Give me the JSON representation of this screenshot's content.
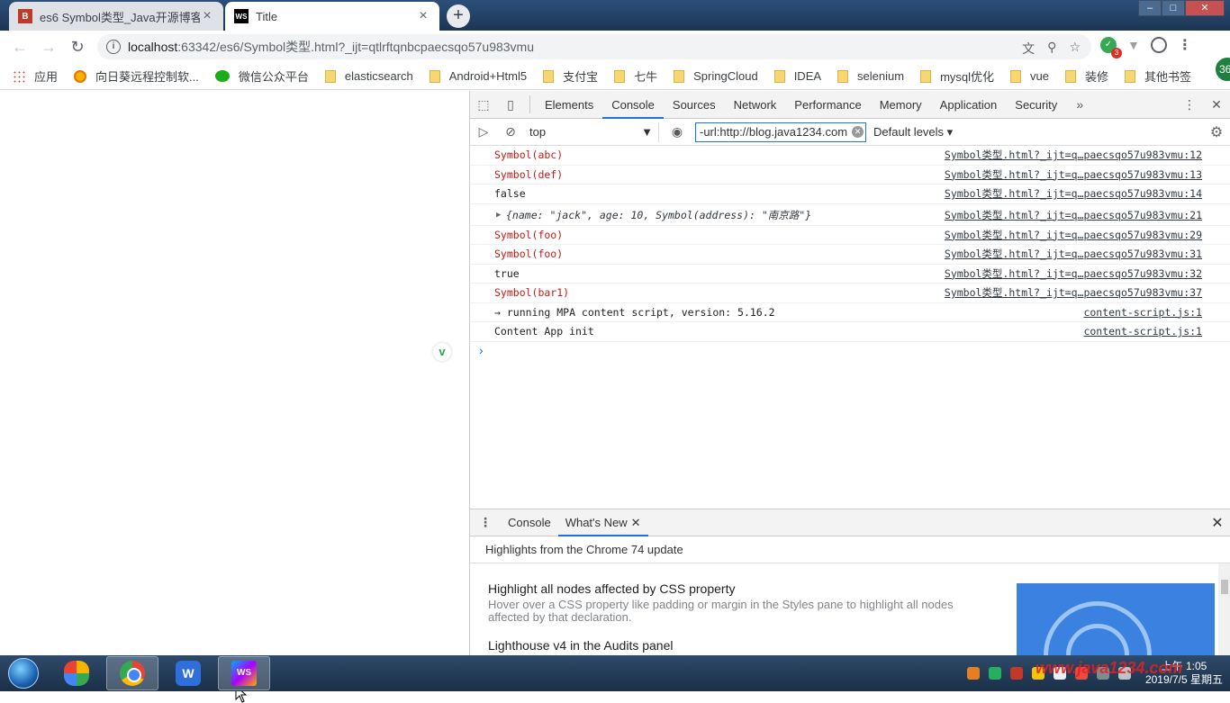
{
  "browser": {
    "tabs": [
      {
        "title": "es6 Symbol类型_Java开源博客系",
        "active": false,
        "favicon": "B"
      },
      {
        "title": "Title",
        "active": true,
        "favicon": "WS"
      }
    ],
    "address": {
      "host": "localhost",
      "rest": ":63342/es6/Symbol类型.html?_ijt=qtlrftqnbcpaecsqo57u983vmu"
    },
    "bookmarks": [
      {
        "label": "应用",
        "icon": "apps-icon"
      },
      {
        "label": "向日葵远程控制软...",
        "icon": "sunflower-icon"
      },
      {
        "label": "微信公众平台",
        "icon": "wechat-icon"
      },
      {
        "label": "elasticsearch",
        "icon": "folder-icon"
      },
      {
        "label": "Android+Html5",
        "icon": "folder-icon"
      },
      {
        "label": "支付宝",
        "icon": "folder-icon"
      },
      {
        "label": "七牛",
        "icon": "folder-icon"
      },
      {
        "label": "SpringCloud",
        "icon": "folder-icon"
      },
      {
        "label": "IDEA",
        "icon": "folder-icon"
      },
      {
        "label": "selenium",
        "icon": "folder-icon"
      },
      {
        "label": "mysql优化",
        "icon": "folder-icon"
      },
      {
        "label": "vue",
        "icon": "folder-icon"
      },
      {
        "label": "装修",
        "icon": "folder-icon"
      },
      {
        "label": "其他书签",
        "icon": "folder-icon"
      }
    ],
    "extension_badge": "3",
    "side_badge": "36"
  },
  "devtools": {
    "tabs": [
      "Elements",
      "Console",
      "Sources",
      "Network",
      "Performance",
      "Memory",
      "Application",
      "Security"
    ],
    "active_tab": "Console",
    "context": "top",
    "filter": "-url:http://blog.java1234.com",
    "levels": "Default levels",
    "messages": [
      {
        "text": "Symbol(abc)",
        "type": "sym",
        "src": "Symbol类型.html?_ijt=q…paecsqo57u983vmu:12"
      },
      {
        "text": "Symbol(def)",
        "type": "sym",
        "src": "Symbol类型.html?_ijt=q…paecsqo57u983vmu:13"
      },
      {
        "text": "false",
        "type": "plain",
        "src": "Symbol类型.html?_ijt=q…paecsqo57u983vmu:14"
      },
      {
        "text": "{name: \"jack\", age: 10, Symbol(address): \"南京路\"}",
        "type": "obj",
        "src": "Symbol类型.html?_ijt=q…paecsqo57u983vmu:21"
      },
      {
        "text": "Symbol(foo)",
        "type": "sym",
        "src": "Symbol类型.html?_ijt=q…paecsqo57u983vmu:29"
      },
      {
        "text": "Symbol(foo)",
        "type": "sym",
        "src": "Symbol类型.html?_ijt=q…paecsqo57u983vmu:31"
      },
      {
        "text": "true",
        "type": "plain",
        "src": "Symbol类型.html?_ijt=q…paecsqo57u983vmu:32"
      },
      {
        "text": "Symbol(bar1)",
        "type": "sym",
        "src": "Symbol类型.html?_ijt=q…paecsqo57u983vmu:37"
      },
      {
        "text": "→ running MPA content script, version: 5.16.2",
        "type": "plain",
        "src": "content-script.js:1"
      },
      {
        "text": "Content App init",
        "type": "plain",
        "src": "content-script.js:1"
      }
    ],
    "drawer": {
      "tabs": [
        "Console",
        "What's New"
      ],
      "active_tab": "What's New",
      "header": "Highlights from the Chrome 74 update",
      "items": [
        {
          "title": "Highlight all nodes affected by CSS property",
          "desc": "Hover over a CSS property like padding or margin in the Styles pane to highlight all nodes affected by that declaration."
        },
        {
          "title": "Lighthouse v4 in the Audits panel",
          "desc": ""
        }
      ]
    }
  },
  "taskbar": {
    "clock_time": "上午 1:05",
    "clock_date": "2019/7/5 星期五",
    "watermark": "www.java1234.com"
  }
}
